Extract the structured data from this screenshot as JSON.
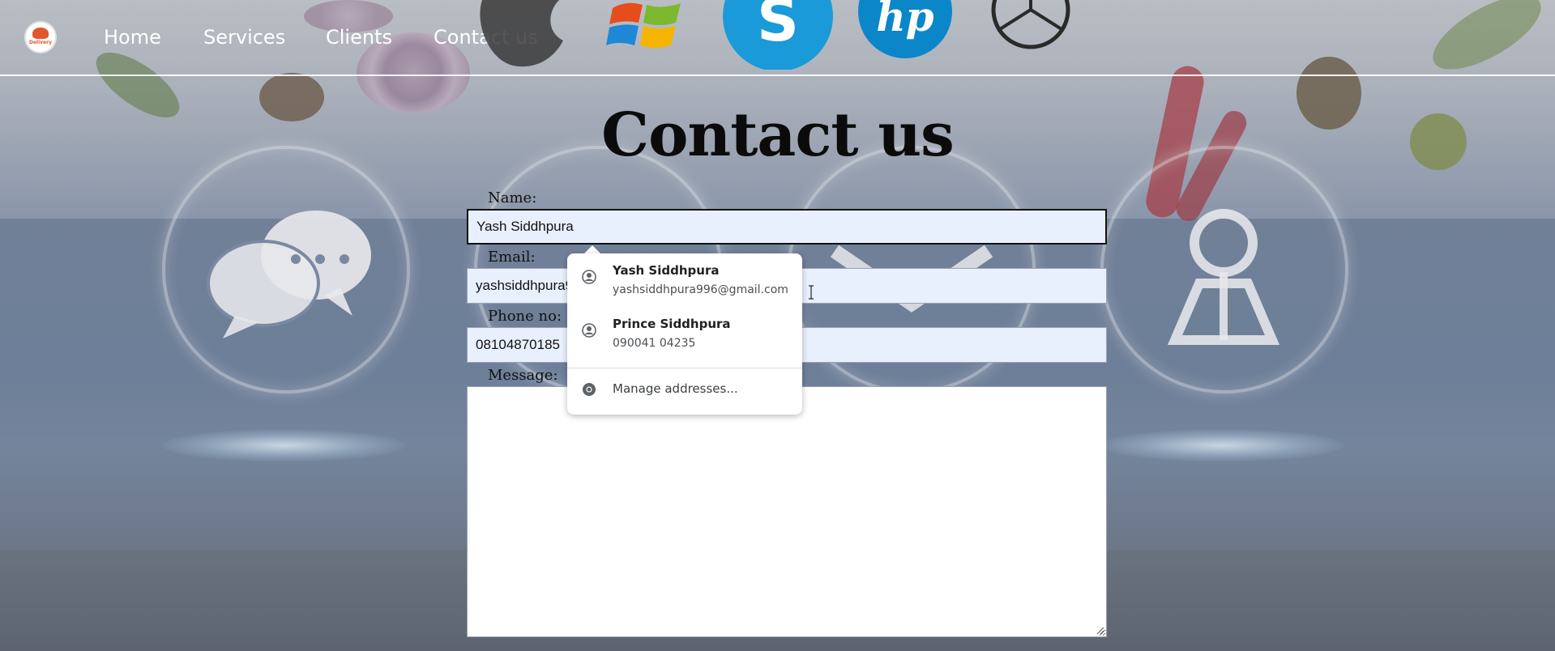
{
  "nav": {
    "logo_text": "Delivery",
    "links": [
      "Home",
      "Services",
      "Clients",
      "Contact us"
    ],
    "brand_icons": [
      "apple-logo-icon",
      "windows-logo-icon",
      "skype-logo-icon",
      "hp-logo-icon",
      "mercedes-logo-icon"
    ]
  },
  "page": {
    "title": "Contact us"
  },
  "form": {
    "name_label": "Name:",
    "name_value": "Yash Siddhpura",
    "email_label": "Email:",
    "email_value": "yashsiddhpura996@gmail.com",
    "phone_label": "Phone no:",
    "phone_value": "08104870185",
    "message_label": "Message:",
    "message_value": ""
  },
  "autofill": {
    "suggestions": [
      {
        "name": "Yash Siddhpura",
        "detail": "yashsiddhpura996@gmail.com"
      },
      {
        "name": "Prince Siddhpura",
        "detail": "090041 04235"
      }
    ],
    "manage_label": "Manage addresses..."
  },
  "colors": {
    "field_bg": "#e9f0fd",
    "logo_accent": "#e2572b",
    "skype_blue": "#1a9ad8",
    "hp_blue": "#0b86c9"
  }
}
